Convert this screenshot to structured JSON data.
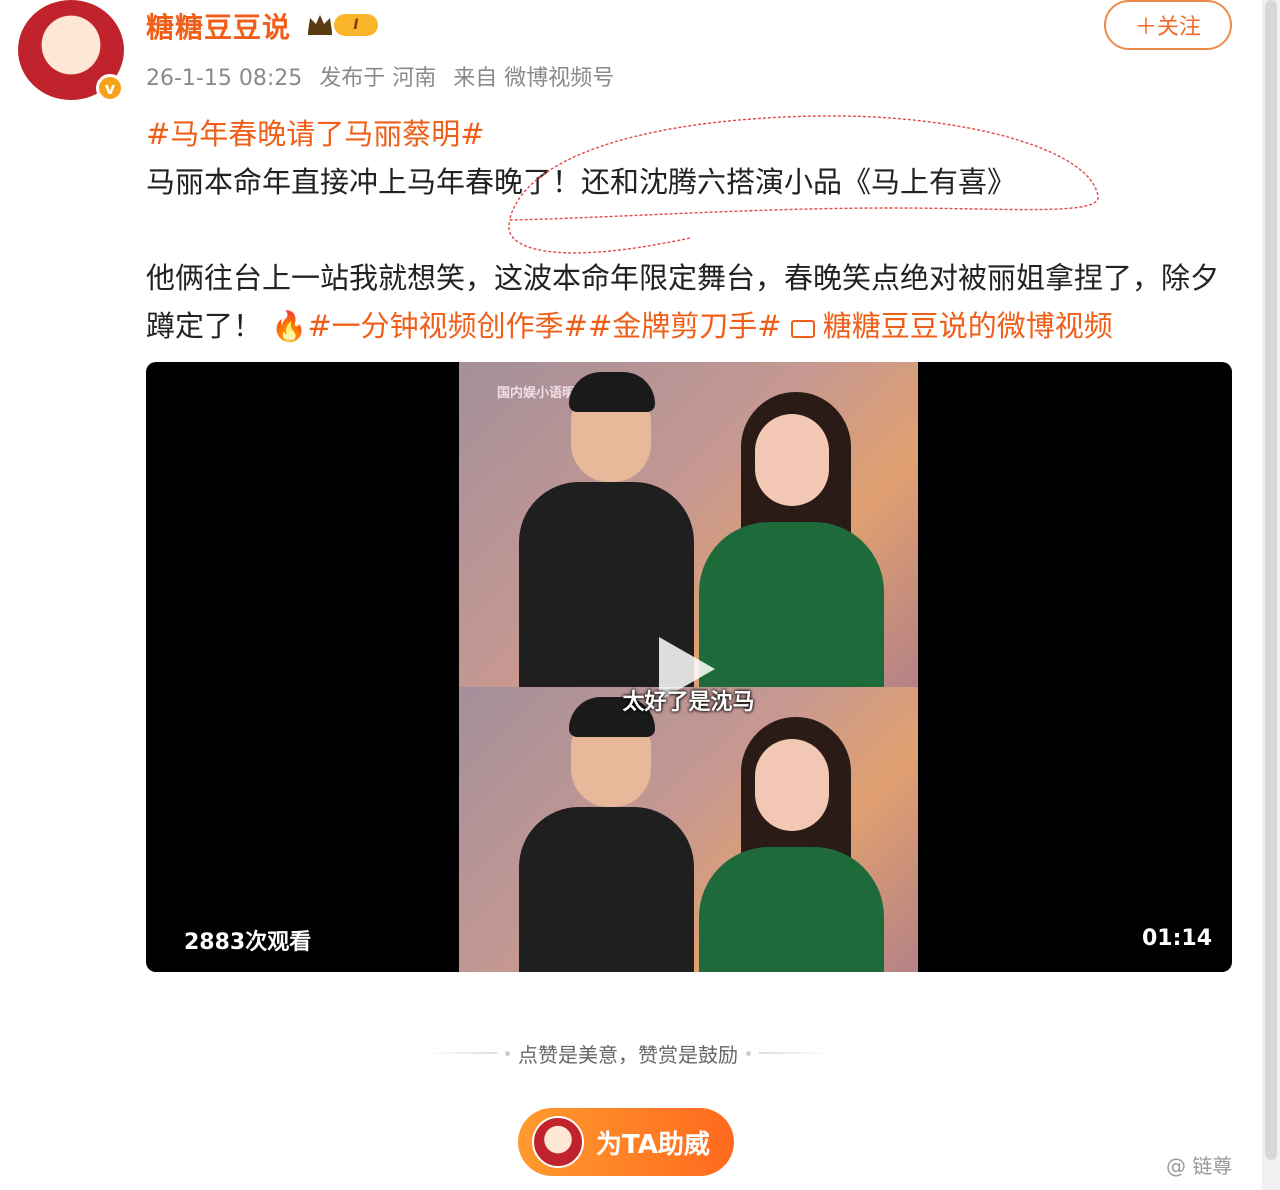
{
  "post": {
    "username": "糖糖豆豆说",
    "level_badge": "I",
    "meta": {
      "datetime": "26-1-15 08:25",
      "published_at": "发布于 河南",
      "source": "来自 微博视频号"
    },
    "follow_label": "＋关注",
    "topic": "#马年春晚请了马丽蔡明#",
    "line1": "马丽本命年直接冲上马年春晚了！还和沈腾六搭演小品《马上有喜》",
    "line2": "他俩往台上一站我就想笑，这波本命年限定舞台，春晚笑点绝对被丽姐拿捏了，除夕蹲定了！",
    "tag1": "#一分钟视频创作季#",
    "tag2": "#金牌剪刀手#",
    "video_link": "糖糖豆豆说的微博视频"
  },
  "video": {
    "frame_watermark": "国内娱小语明",
    "subtitle": "太好了是沈马",
    "views": "2883次观看",
    "duration": "01:14"
  },
  "footer": {
    "encourage": "点赞是美意，赞赏是鼓励",
    "cheer_label": "为TA助威"
  },
  "watermark": "@ 链尊",
  "colors": {
    "accent": "#f05f19",
    "follow_border": "#f08a4b",
    "cheer_gradient_start": "#ff9a2e",
    "cheer_gradient_end": "#ff6a1f"
  }
}
